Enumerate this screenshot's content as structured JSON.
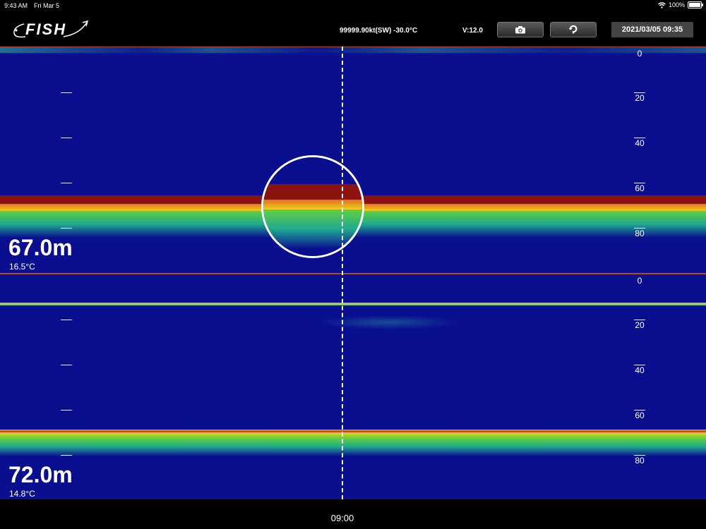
{
  "status_bar": {
    "time": "9:43 AM",
    "date": "Fri Mar 5",
    "battery": "100%"
  },
  "app": {
    "logo": "FISH",
    "speed_temp": "99999.90kt(SW) -30.0°C",
    "voltage": "V:12.0",
    "datetime": "2021/03/05 09:35",
    "camera_icon": "camera-icon",
    "help_icon": "rotate-icon"
  },
  "top_panel": {
    "depth": "67.0m",
    "temperature": "16.5°C",
    "scale": [
      "0",
      "20",
      "40",
      "60",
      "80"
    ]
  },
  "bottom_panel": {
    "depth": "72.0m",
    "temperature": "14.8°C",
    "scale": [
      "0",
      "20",
      "40",
      "60",
      "80"
    ]
  },
  "footer": {
    "cursor_time": "09:00"
  },
  "colors": {
    "water": "#0a0f8f",
    "bottom_echo": "#8b1410",
    "mid_echo": "#f0d020",
    "weak_echo": "#2ec0a0"
  }
}
